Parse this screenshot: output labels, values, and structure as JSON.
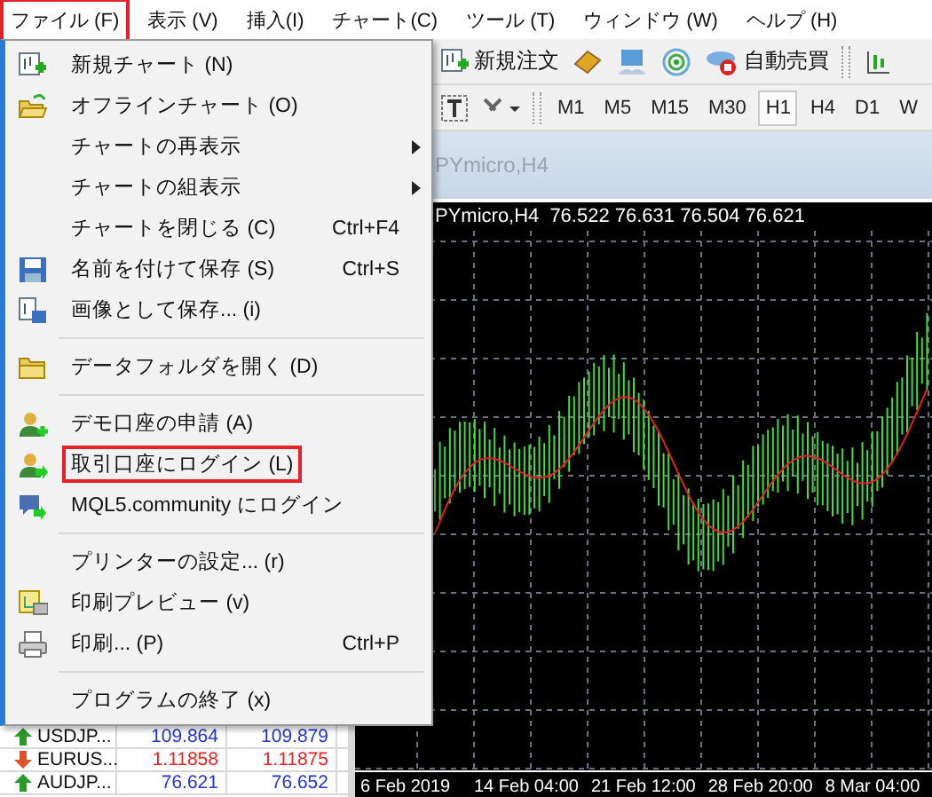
{
  "menubar": [
    {
      "label": "ファイル (F)",
      "highlighted": true
    },
    {
      "label": "表示 (V)",
      "highlighted": false
    },
    {
      "label": "挿入(I)",
      "highlighted": false
    },
    {
      "label": "チャート(C)",
      "highlighted": false
    },
    {
      "label": "ツール (T)",
      "highlighted": false
    },
    {
      "label": "ウィンドウ (W)",
      "highlighted": false
    },
    {
      "label": "ヘルプ (H)",
      "highlighted": false
    }
  ],
  "toolbar": {
    "buttons": [
      {
        "label": "新規注文"
      },
      {
        "label": "自動売買"
      }
    ],
    "timeframes": [
      {
        "label": "M1",
        "selected": false
      },
      {
        "label": "M5",
        "selected": false
      },
      {
        "label": "M15",
        "selected": false
      },
      {
        "label": "M30",
        "selected": false
      },
      {
        "label": "H1",
        "selected": true
      },
      {
        "label": "H4",
        "selected": false
      },
      {
        "label": "D1",
        "selected": false
      },
      {
        "label": "W",
        "selected": false
      }
    ]
  },
  "file_menu": {
    "items": [
      {
        "kind": "item",
        "label": "新規チャート (N)",
        "submenu": false,
        "highlighted": false
      },
      {
        "kind": "item",
        "label": "オフラインチャート (O)",
        "submenu": false,
        "highlighted": false
      },
      {
        "kind": "item",
        "label": "チャートの再表示",
        "submenu": true,
        "highlighted": false
      },
      {
        "kind": "item",
        "label": "チャートの組表示",
        "submenu": true,
        "highlighted": false
      },
      {
        "kind": "item",
        "label": "チャートを閉じる (C)",
        "shortcut": "Ctrl+F4",
        "submenu": false,
        "highlighted": false
      },
      {
        "kind": "item",
        "label": "名前を付けて保存 (S)",
        "shortcut": "Ctrl+S",
        "submenu": false,
        "highlighted": false
      },
      {
        "kind": "item",
        "label": "画像として保存... (i)",
        "submenu": false,
        "highlighted": false
      },
      {
        "kind": "separator"
      },
      {
        "kind": "item",
        "label": "データフォルダを開く (D)",
        "submenu": false,
        "highlighted": false
      },
      {
        "kind": "separator"
      },
      {
        "kind": "item",
        "label": "デモ口座の申請 (A)",
        "submenu": false,
        "highlighted": false
      },
      {
        "kind": "item",
        "label": "取引口座にログイン (L)",
        "submenu": false,
        "highlighted": true
      },
      {
        "kind": "item",
        "label": "MQL5.community にログイン",
        "submenu": false,
        "highlighted": false
      },
      {
        "kind": "separator"
      },
      {
        "kind": "item",
        "label": "プリンターの設定... (r)",
        "submenu": false,
        "highlighted": false
      },
      {
        "kind": "item",
        "label": "印刷プレビュー (v)",
        "submenu": false,
        "highlighted": false
      },
      {
        "kind": "item",
        "label": "印刷... (P)",
        "shortcut": "Ctrl+P",
        "submenu": false,
        "highlighted": false
      },
      {
        "kind": "separator"
      },
      {
        "kind": "item",
        "label": "プログラムの終了 (x)",
        "submenu": false,
        "highlighted": false
      }
    ]
  },
  "market_watch": {
    "rows": [
      {
        "symbol": "USDJP...",
        "bid": "109.864",
        "ask": "109.879",
        "rising": true
      },
      {
        "symbol": "EURUS...",
        "bid": "1.11858",
        "ask": "1.11875",
        "rising": false
      },
      {
        "symbol": "AUDJP...",
        "bid": "76.621",
        "ask": "76.652",
        "rising": true
      }
    ]
  },
  "chart": {
    "tab_title": "PYmicro,H4",
    "symbol": "PYmicro,H4",
    "ohlc": "76.522 76.631 76.504 76.621",
    "time_labels": [
      "6 Feb 2019",
      "14 Feb 04:00",
      "21 Feb 12:00",
      "28 Feb 20:00",
      "8 Mar 04:00"
    ]
  }
}
